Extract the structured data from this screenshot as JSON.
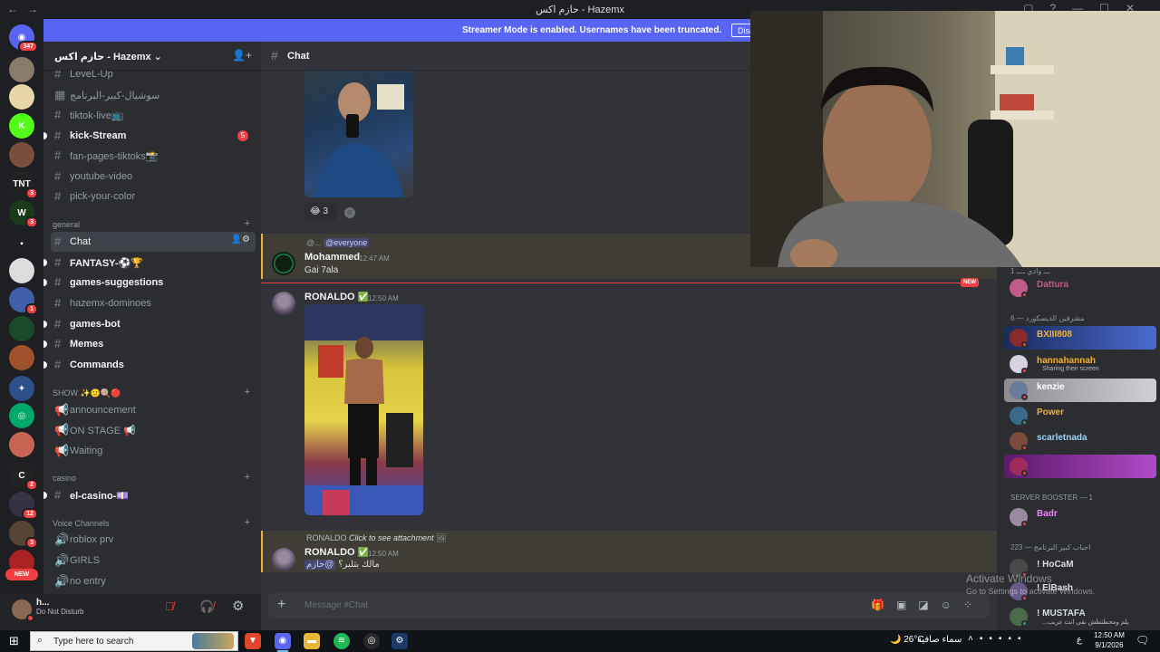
{
  "window": {
    "title": "حازم اكس - Hazemx",
    "nav_icons": [
      "←",
      "→"
    ],
    "controls": [
      "▢",
      "?",
      "—",
      "☐",
      "✕"
    ]
  },
  "banner": {
    "text": "Streamer Mode is enabled. Usernames have been truncated.",
    "button": "Disable"
  },
  "servers": [
    {
      "glyph": "◉",
      "color": "#5865f2",
      "badge": "347"
    },
    {
      "glyph": "",
      "color": "#8a7a6a",
      "badge": ""
    },
    {
      "glyph": "",
      "color": "#e7d6a6",
      "badge": ""
    },
    {
      "glyph": "K",
      "color": "#53fc18",
      "badge": ""
    },
    {
      "glyph": "",
      "color": "#7a4d3c",
      "badge": ""
    },
    {
      "glyph": "TNT",
      "color": "#222222",
      "badge": "3"
    },
    {
      "glyph": "W",
      "color": "#1a3a1a",
      "badge": "3"
    },
    {
      "glyph": "▪",
      "color": "#1e1f22",
      "badge": ""
    },
    {
      "glyph": "",
      "color": "#dcdcdc",
      "badge": ""
    },
    {
      "glyph": "",
      "color": "#3f5fa8",
      "badge": "1"
    },
    {
      "glyph": "",
      "color": "#1a4a2a",
      "badge": ""
    },
    {
      "glyph": "",
      "color": "#a0522d",
      "badge": ""
    },
    {
      "glyph": "✦",
      "color": "#2d4f8a",
      "badge": ""
    },
    {
      "glyph": "◎",
      "color": "#00a86b",
      "badge": ""
    },
    {
      "glyph": "",
      "color": "#c86454",
      "badge": ""
    },
    {
      "glyph": "C",
      "color": "#222222",
      "badge": "2"
    },
    {
      "glyph": "",
      "color": "#333344",
      "badge": "12"
    },
    {
      "glyph": "",
      "color": "#554433",
      "badge": "3"
    },
    {
      "glyph": "",
      "color": "#aa2222",
      "badge": ""
    }
  ],
  "guild": {
    "name": "حازم اكس - Hazemx",
    "chevron": "⌄",
    "invite_icon": "👤+"
  },
  "channels_top": [
    {
      "name": "LeveL-Up",
      "unread": false
    },
    {
      "name": "سوشيال-كبير-البرنامج",
      "unread": false
    },
    {
      "name": "tiktok-live📺",
      "unread": false
    },
    {
      "name": "kick-Stream",
      "unread": true,
      "mention": "5"
    },
    {
      "name": "fan-pages-tiktoks📸",
      "unread": false
    },
    {
      "name": "youtube-video",
      "unread": false
    },
    {
      "name": "pick-your-color",
      "unread": false
    }
  ],
  "cat_general": "general",
  "channels_general": [
    {
      "name": "Chat",
      "unread": false,
      "active": true
    },
    {
      "name": "FANTASY-⚽🏆",
      "unread": true
    },
    {
      "name": "games-suggestions",
      "unread": true
    },
    {
      "name": "hazemx-dominoes",
      "unread": false
    },
    {
      "name": "games-bot",
      "unread": true
    },
    {
      "name": "Memes",
      "unread": true
    },
    {
      "name": "Commands",
      "unread": true
    }
  ],
  "cat_show": "SHOW ✨🙂🍭🔴",
  "channels_show": [
    {
      "name": "announcement",
      "unread": false
    },
    {
      "name": "ON STAGE 📢",
      "unread": false
    },
    {
      "name": "Waiting",
      "unread": false
    }
  ],
  "cat_casino": "casino",
  "channels_casino": [
    {
      "name": "el-casino-💷",
      "unread": true
    }
  ],
  "cat_voice": "Voice Channels",
  "channels_voice": [
    {
      "name": "roblox prv",
      "unread": false
    },
    {
      "name": "GIRLS",
      "unread": false
    },
    {
      "name": "no entry",
      "unread": false
    }
  ],
  "user": {
    "name": "h...",
    "status": "Do Not Disturb"
  },
  "chat": {
    "channel": "Chat",
    "reaction_emoji": "😂",
    "reaction_count": "3",
    "msg1": {
      "reply_user": "@...",
      "reply_mention": "@everyone",
      "author": "Mohammed",
      "time": "12:47 AM",
      "text": "Gai 7ala"
    },
    "new_label": "NEW",
    "msg2": {
      "author": "RONALDO",
      "time": "12:50 AM"
    },
    "msg3": {
      "reply_author": "RONALDO",
      "reply_text": "Click to see attachment",
      "author": "RONALDO",
      "time": "12:50 AM",
      "text": "مالك بتلبر؟",
      "mention": "@حازم"
    },
    "placeholder": "Message #Chat"
  },
  "members": {
    "group_top": "ـــ وادي ــــ 1",
    "group_discord": "مشرفين الديسكورد — 6",
    "group_booster": "SERVER BOOSTER — 1",
    "group_fans": "احباب كبير البرنامج — 223",
    "list": [
      {
        "name": "Dattura",
        "color": "#c05b8a",
        "sub": "",
        "status": "#f23f43"
      },
      {
        "name": "BXIII808",
        "color": "#f0b232",
        "sub": "",
        "status": "#f23f43"
      },
      {
        "name": "hannahannah",
        "color": "#f0b232",
        "sub": "Sharing their screen",
        "status": "#f23f43"
      },
      {
        "name": "kenzie",
        "color": "#ffffff",
        "sub": "",
        "status": "#f23f43"
      },
      {
        "name": "Power",
        "color": "#f0b232",
        "sub": "",
        "status": "#23a55a"
      },
      {
        "name": "scarletnada",
        "color": "#9ad3f5",
        "sub": "",
        "status": "#f23f43"
      },
      {
        "name": "",
        "color": "#c64bc8",
        "sub": "",
        "status": "#f23f43"
      },
      {
        "name": "Badr",
        "color": "#f47fff",
        "sub": "",
        "status": "#f23f43"
      },
      {
        "name": "! HoCaM",
        "color": "#dbdee1",
        "sub": "",
        "status": "#f23f43"
      },
      {
        "name": "! ElBash",
        "color": "#dbdee1",
        "sub": "",
        "status": "#f23f43"
      },
      {
        "name": "! MUSTAFA",
        "color": "#dbdee1",
        "sub": "...يلم ومحطتطش بقى انت عريب",
        "status": "#23a55a"
      }
    ]
  },
  "watermark": {
    "line1": "Activate Windows",
    "line2": "Go to Settings to activate Windows."
  },
  "taskbar": {
    "search_placeholder": "Type here to search",
    "weather_temp": "26°C",
    "weather_desc": "سماء صافية",
    "lang": "ع",
    "time": "12:50 AM",
    "date": "9/1/2026"
  }
}
